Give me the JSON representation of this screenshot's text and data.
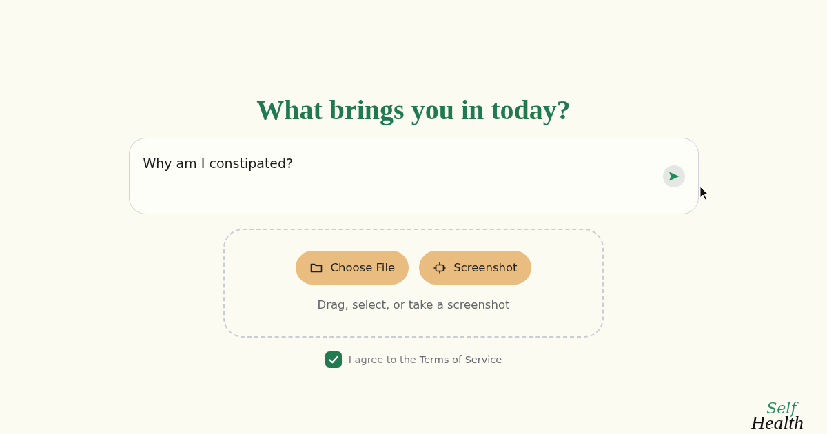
{
  "heading": "What brings you in today?",
  "query": {
    "value": "Why am I constipated?"
  },
  "upload": {
    "buttons": [
      {
        "kind": "file",
        "label": "Choose File"
      },
      {
        "kind": "screenshot",
        "label": "Screenshot"
      }
    ],
    "hint": "Drag, select, or take a screenshot"
  },
  "agreement": {
    "checked": true,
    "text": "I agree to the",
    "link": "Terms of Service"
  },
  "logo": {
    "line_1": "Self",
    "line_2": "Health"
  }
}
